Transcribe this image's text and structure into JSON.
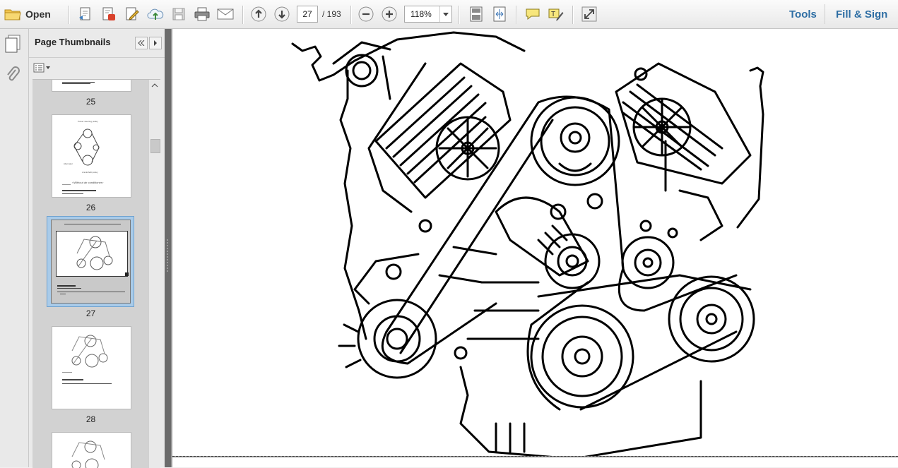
{
  "toolbar": {
    "open_label": "Open",
    "page_current": "27",
    "page_total": "/ 193",
    "zoom": "118%",
    "tools_label": "Tools",
    "fill_sign_label": "Fill & Sign"
  },
  "panel": {
    "title": "Page Thumbnails",
    "thumbnails": [
      {
        "label": "25"
      },
      {
        "label": "26",
        "caption_top": "Power steering pulley",
        "caption_left": "Alternator",
        "caption_mid": "crankshaft pulley",
        "caption_bottom": "<Without air conditioner>"
      },
      {
        "label": "27",
        "selected": true
      },
      {
        "label": "28"
      }
    ]
  },
  "document": {
    "figure": "engine drive belt diagram"
  },
  "colors": {
    "accent_link": "#2e6ea4",
    "selected_thumb": "#a9cbe9",
    "splitter": "#6c6c6c"
  }
}
